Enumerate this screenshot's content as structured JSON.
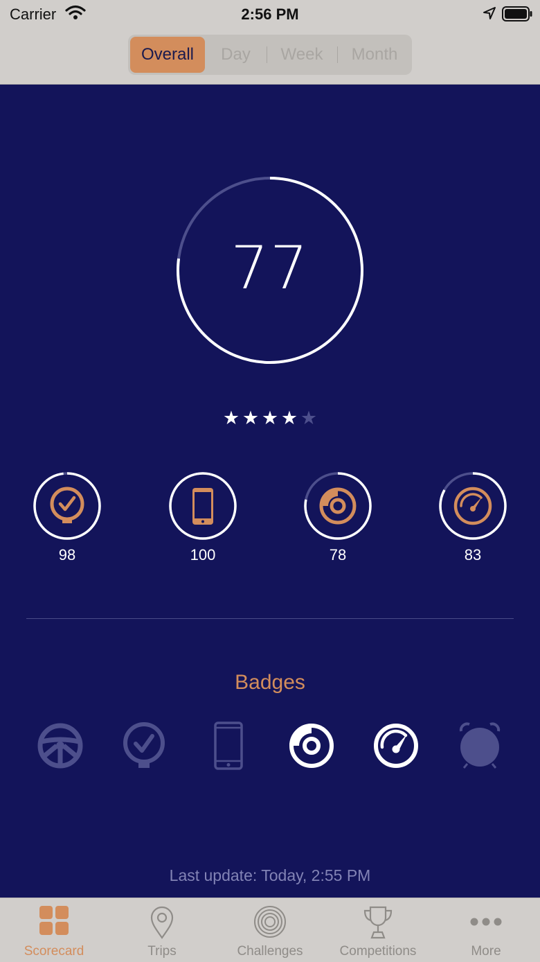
{
  "status_bar": {
    "carrier": "Carrier",
    "time": "2:56 PM"
  },
  "segment": {
    "options": [
      "Overall",
      "Day",
      "Week",
      "Month"
    ],
    "selected": "Overall"
  },
  "score": {
    "value": "77",
    "progress": 0.77
  },
  "rating": {
    "stars_filled": 4,
    "stars_total": 5
  },
  "metrics": [
    {
      "icon": "check-badge-icon",
      "value": "98",
      "progress": 0.98
    },
    {
      "icon": "phone-icon",
      "value": "100",
      "progress": 1.0
    },
    {
      "icon": "brake-disc-icon",
      "value": "78",
      "progress": 0.78
    },
    {
      "icon": "speedometer-icon",
      "value": "83",
      "progress": 0.83
    }
  ],
  "badges": {
    "title": "Badges",
    "items": [
      {
        "icon": "steering-wheel-icon",
        "earned": false
      },
      {
        "icon": "check-badge-icon",
        "earned": false
      },
      {
        "icon": "phone-icon",
        "earned": false
      },
      {
        "icon": "brake-disc-icon",
        "earned": true
      },
      {
        "icon": "speedometer-icon",
        "earned": true
      },
      {
        "icon": "alarm-clock-icon",
        "earned": false
      }
    ]
  },
  "last_update": "Last update: Today, 2:55 PM",
  "tabbar": {
    "items": [
      {
        "label": "Scorecard",
        "icon": "grid-icon",
        "active": true
      },
      {
        "label": "Trips",
        "icon": "map-pin-icon",
        "active": false
      },
      {
        "label": "Challenges",
        "icon": "target-rings-icon",
        "active": false
      },
      {
        "label": "Competitions",
        "icon": "trophy-icon",
        "active": false
      },
      {
        "label": "More",
        "icon": "more-dots-icon",
        "active": false
      }
    ]
  },
  "colors": {
    "background": "#13145a",
    "accent": "#d38d5c",
    "bars": "#d1cecb",
    "muted": "#4d4f8c"
  }
}
